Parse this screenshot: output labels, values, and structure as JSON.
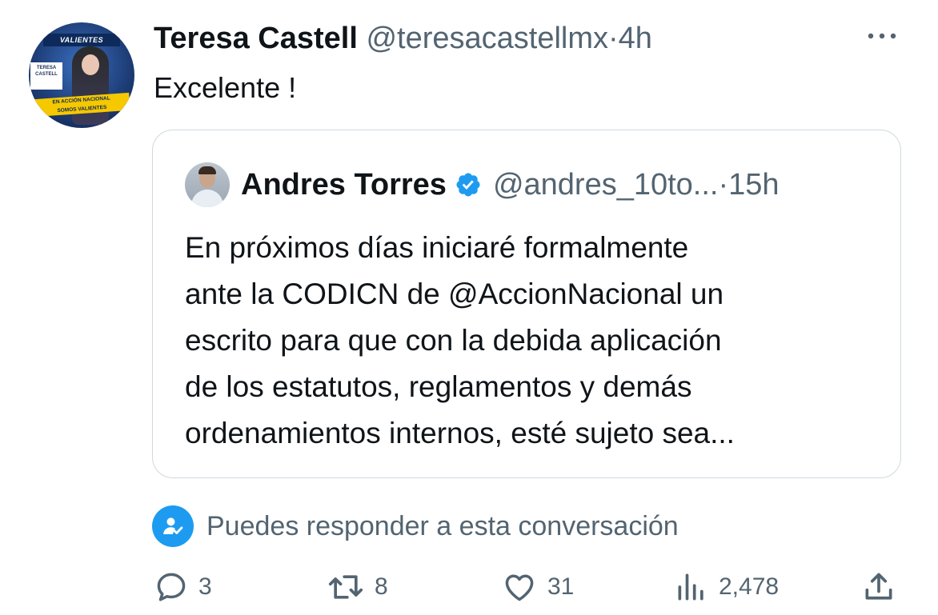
{
  "tweet": {
    "author_name": "Teresa Castell",
    "handle": "@teresacastellmx",
    "separator": "·",
    "time": "4h",
    "text": "Excelente !",
    "avatar_text": {
      "top_banner": "VALIENTES",
      "name_card": "TERESA CASTELL",
      "bottom_banner_line1": "EN ACCIÓN NACIONAL",
      "bottom_banner_line2": "SOMOS VALIENTES"
    }
  },
  "quoted_tweet": {
    "author_name": "Andres Torres",
    "verified": true,
    "handle": "@andres_10to...",
    "separator": "·",
    "time": "15h",
    "lines": [
      "En próximos días iniciaré formalmente",
      "ante la CODICN de @AccionNacional un",
      "escrito para que con la debida aplicación",
      "de los estatutos, reglamentos y demás",
      "ordenamientos internos, esté sujeto sea..."
    ]
  },
  "reply_notice": "Puedes responder a esta conversación",
  "actions": {
    "replies": "3",
    "reposts": "8",
    "likes": "31",
    "views": "2,478"
  },
  "icons": {
    "more": "more-icon",
    "verified": "verified-badge-icon",
    "reply_permission": "person-check-icon",
    "reply": "reply-icon",
    "repost": "repost-icon",
    "like": "heart-icon",
    "views": "views-icon",
    "share": "share-icon"
  },
  "colors": {
    "accent": "#1d9bf0",
    "text": "#0f1419",
    "muted": "#536471",
    "border": "#cfd9de"
  }
}
